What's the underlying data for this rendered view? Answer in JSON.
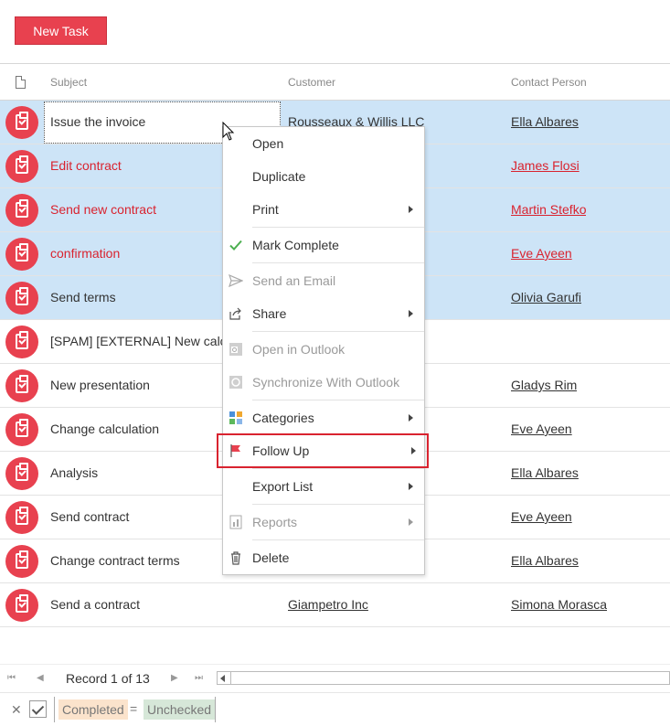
{
  "toolbar": {
    "new_task_label": "New Task"
  },
  "columns": {
    "subject": "Subject",
    "customer": "Customer",
    "contact": "Contact Person"
  },
  "rows": [
    {
      "subject": "Issue the invoice",
      "customer": "Rousseaux & Willis LLC",
      "contact": "Ella Albares",
      "selected": true,
      "overdue": false
    },
    {
      "subject": "Edit contract",
      "customer": "",
      "contact": "James Flosi",
      "selected": true,
      "overdue": true
    },
    {
      "subject": "Send new contract",
      "customer": "",
      "contact": "Martin Stefko",
      "selected": true,
      "overdue": true
    },
    {
      "subject": "confirmation",
      "customer": "",
      "contact": "Eve Ayeen",
      "selected": true,
      "overdue": true
    },
    {
      "subject": "Send terms",
      "customer": "",
      "contact": "Olivia Garufi",
      "selected": true,
      "overdue": false
    },
    {
      "subject": "[SPAM] [EXTERNAL] New calculation",
      "customer": "",
      "contact": "",
      "selected": false,
      "overdue": false
    },
    {
      "subject": "New presentation",
      "customer": "",
      "contact": "Gladys Rim",
      "selected": false,
      "overdue": false
    },
    {
      "subject": "Change calculation",
      "customer": "",
      "contact": "Eve Ayeen",
      "selected": false,
      "overdue": false
    },
    {
      "subject": "Analysis",
      "customer": "",
      "contact": "Ella Albares",
      "selected": false,
      "overdue": false
    },
    {
      "subject": "Send contract",
      "customer": "",
      "contact": "Eve Ayeen",
      "selected": false,
      "overdue": false
    },
    {
      "subject": "Change contract terms",
      "customer": "",
      "contact": "Ella Albares",
      "selected": false,
      "overdue": false
    },
    {
      "subject": "Send a contract",
      "customer": "Giampetro Inc",
      "contact": "Simona Morasca",
      "selected": false,
      "overdue": false
    }
  ],
  "context_menu": {
    "open": "Open",
    "duplicate": "Duplicate",
    "print": "Print",
    "mark_complete": "Mark Complete",
    "send_email": "Send an Email",
    "share": "Share",
    "open_outlook": "Open in Outlook",
    "sync_outlook": "Synchronize With Outlook",
    "categories": "Categories",
    "follow_up": "Follow Up",
    "export_list": "Export List",
    "reports": "Reports",
    "delete": "Delete"
  },
  "pager": {
    "record_text": "Record 1 of 13"
  },
  "filter": {
    "field": "Completed",
    "operator": "=",
    "value": "Unchecked"
  },
  "colors": {
    "accent": "#e8414f",
    "selection": "#cde4f7",
    "overdue_text": "#d9232f"
  }
}
